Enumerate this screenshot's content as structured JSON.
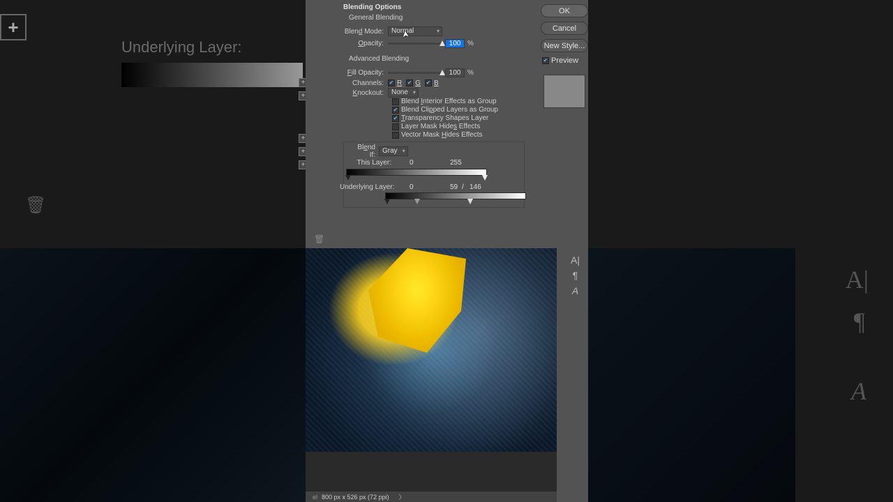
{
  "dialog": {
    "title": "Blending Options",
    "general": {
      "heading": "General Blending",
      "blend_mode_label": "Blend Mode:",
      "blend_mode_value": "Normal",
      "opacity_label": "Opacity:",
      "opacity_value": "100",
      "opacity_unit": "%"
    },
    "advanced": {
      "heading": "Advanced Blending",
      "fill_opacity_label": "Fill Opacity:",
      "fill_opacity_value": "100",
      "fill_opacity_unit": "%",
      "channels_label": "Channels:",
      "channel_r": "R",
      "channel_g": "G",
      "channel_b": "B",
      "knockout_label": "Knockout:",
      "knockout_value": "None",
      "opt_interior": "Blend Interior Effects as Group",
      "opt_clipped": "Blend Clipped Layers as Group",
      "opt_transparency": "Transparency Shapes Layer",
      "opt_layermask": "Layer Mask Hides Effects",
      "opt_vectormask": "Vector Mask Hides Effects"
    },
    "blendif": {
      "label": "Blend If:",
      "value": "Gray",
      "this_layer_label": "This Layer:",
      "this_low": "0",
      "this_high": "255",
      "underlying_label": "Underlying Layer:",
      "under_low": "0",
      "under_mid": "59",
      "under_sep": "/",
      "under_high": "146"
    }
  },
  "buttons": {
    "ok": "OK",
    "cancel": "Cancel",
    "new_style": "New Style...",
    "preview": "Preview"
  },
  "status": {
    "dimensions": "800 px x 526 px (72 ppi)"
  },
  "bg": {
    "underlying": "Underlying Layer:"
  }
}
